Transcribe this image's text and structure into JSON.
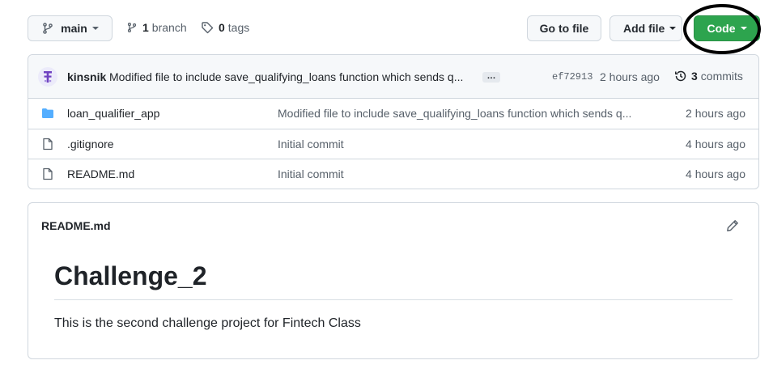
{
  "toolbar": {
    "branch_select": "main",
    "branch_count": "1",
    "branch_label": "branch",
    "tag_count": "0",
    "tag_label": "tags",
    "go_to_file": "Go to file",
    "add_file": "Add file",
    "code": "Code"
  },
  "colors": {
    "code_button_bg": "#2da44e",
    "folder_icon": "#54aeff"
  },
  "commit": {
    "author": "kinsnik",
    "message": "Modified file to include save_qualifying_loans function which sends q...",
    "ellipsis": "…",
    "sha": "ef72913",
    "time": "2 hours ago",
    "commit_count": "3",
    "commits_label": "commits"
  },
  "files": [
    {
      "icon": "folder-icon",
      "name": "loan_qualifier_app",
      "message": "Modified file to include save_qualifying_loans function which sends q...",
      "age": "2 hours ago"
    },
    {
      "icon": "file-icon",
      "name": ".gitignore",
      "message": "Initial commit",
      "age": "4 hours ago"
    },
    {
      "icon": "file-icon",
      "name": "README.md",
      "message": "Initial commit",
      "age": "4 hours ago"
    }
  ],
  "readme": {
    "filename": "README.md",
    "heading": "Challenge_2",
    "body": "This is the second challenge project for Fintech Class"
  }
}
